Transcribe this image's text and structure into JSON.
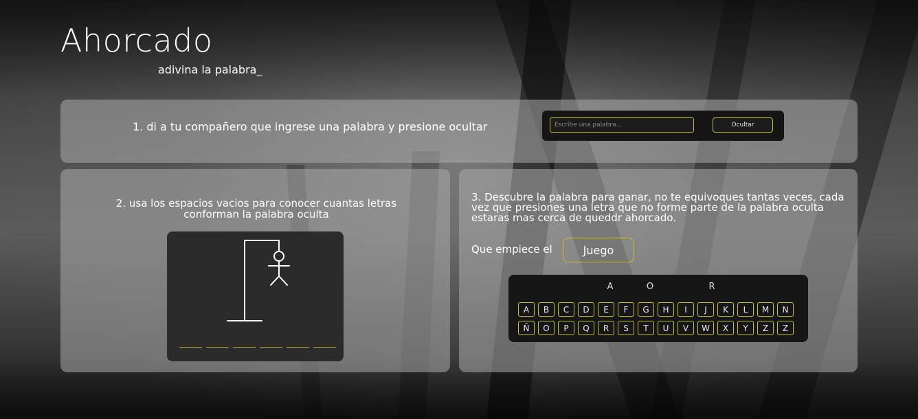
{
  "header": {
    "title": "Ahorcado",
    "subtitle": "adivina la palabra_"
  },
  "step1": {
    "instruction": "1. di a tu compañero que ingrese una palabra y presione ocultar",
    "input_placeholder": "Escribe una palabra...",
    "hide_label": "Ocultar"
  },
  "step2": {
    "instruction": "2. usa los espacios vacios para conocer cuantas letras conforman la palabra oculta",
    "slot_count": 6
  },
  "step3": {
    "instruction": "3. Descubre la palabra para ganar, no te equivoques tantas veces, cada vez que presiones una letra que no forme parte de la palabra oculta estaras mas cerca de queddr ahorcado.",
    "start_label": "Que empiece el",
    "game_button": "Juego",
    "revealed": [
      "A",
      "O",
      "R"
    ],
    "keys_row1": [
      "A",
      "B",
      "C",
      "D",
      "E",
      "F",
      "G",
      "H",
      "I",
      "J",
      "K",
      "L",
      "M",
      "N"
    ],
    "keys_row2": [
      "Ñ",
      "O",
      "P",
      "Q",
      "R",
      "S",
      "T",
      "U",
      "V",
      "W",
      "X",
      "Y",
      "Z",
      "Z"
    ]
  },
  "colors": {
    "accent": "#c9c22a",
    "panel": "#aaaaaa",
    "dark_box": "#161616"
  }
}
